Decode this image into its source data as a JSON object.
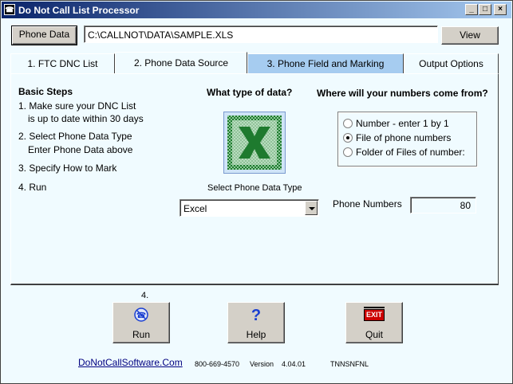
{
  "window": {
    "title": "Do Not Call List Processor",
    "title_icon": "app-icon",
    "controls": [
      "minimize",
      "maximize",
      "close"
    ]
  },
  "toolbar": {
    "phone_data_label": "Phone Data",
    "path_value": "C:\\CALLNOT\\DATA\\SAMPLE.XLS",
    "view_label": "View"
  },
  "tabs": [
    {
      "label": "1. FTC DNC List",
      "active": false
    },
    {
      "label": "2. Phone Data Source",
      "active": true
    },
    {
      "label": "3. Phone Field and Marking",
      "active": false
    },
    {
      "label": "Output Options",
      "active": false
    }
  ],
  "basic_steps": {
    "heading": "Basic Steps",
    "lines": [
      "1. Make sure your DNC List",
      "is up to date within 30 days",
      "2. Select Phone Data Type",
      "Enter Phone Data  above",
      "3. Specify How to Mark",
      "4. Run"
    ]
  },
  "data_type": {
    "question": "What type of data?",
    "icon": "excel-icon",
    "select_label": "Select Phone Data Type",
    "selected": "Excel"
  },
  "source": {
    "question": "Where will your numbers come from?",
    "options": [
      {
        "label": "Number - enter 1 by 1",
        "checked": false
      },
      {
        "label": "File of phone numbers",
        "checked": true
      },
      {
        "label": "Folder of Files of number:",
        "checked": false
      }
    ],
    "phone_numbers_label": "Phone Numbers",
    "phone_numbers_value": "80"
  },
  "actions": {
    "step_label": "4.",
    "run_label": "Run",
    "help_label": "Help",
    "quit_label": "Quit",
    "exit_sign_text": "EXIT"
  },
  "footer": {
    "website": "DoNotCallSoftware.Com",
    "phone": "800-669-4570",
    "version_label": "Version",
    "version_value": "4.04.01",
    "code": "TNNSNFNL"
  },
  "colors": {
    "panel_bg": "#f0fbff",
    "active_tab_blue": "#a6ccf0",
    "titlebar_start": "#0a246a",
    "titlebar_end": "#a6caf0",
    "excel_green": "#1e7a2e",
    "exit_red": "#cc0000",
    "help_blue": "#1a3fd1"
  }
}
